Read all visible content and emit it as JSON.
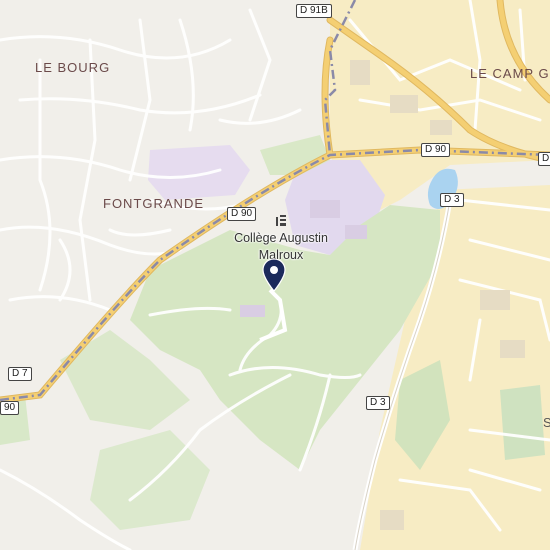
{
  "map": {
    "colors": {
      "background": "#f1efea",
      "urban_yellow": "#f7ecc4",
      "vegetation": "#d8e7c5",
      "school_area": "#e2d9ee",
      "water": "#aad3f0",
      "main_road": "#f4cf73",
      "border": "#8a8aa8",
      "pin": "#1b2a5b"
    },
    "places": [
      {
        "id": "le-bourg",
        "label": "LE BOURG"
      },
      {
        "id": "le-camp",
        "label": "LE CAMP G"
      },
      {
        "id": "fontgrande",
        "label": "FONTGRANDE"
      }
    ],
    "roads": [
      {
        "id": "d91b",
        "label": "D 91B"
      },
      {
        "id": "d90-east",
        "label": "D 90"
      },
      {
        "id": "d90-center",
        "label": "D 90"
      },
      {
        "id": "d90-edge",
        "label": "D"
      },
      {
        "id": "d3-north",
        "label": "D 3"
      },
      {
        "id": "d3-south",
        "label": "D 3"
      },
      {
        "id": "d7",
        "label": "D 7"
      },
      {
        "id": "d90-west",
        "label": "90"
      }
    ],
    "poi": {
      "icon": "school-icon",
      "line1": "Collège Augustin",
      "line2": "Malroux"
    },
    "marker": {
      "icon": "map-pin-icon"
    },
    "edge_label": "S"
  }
}
